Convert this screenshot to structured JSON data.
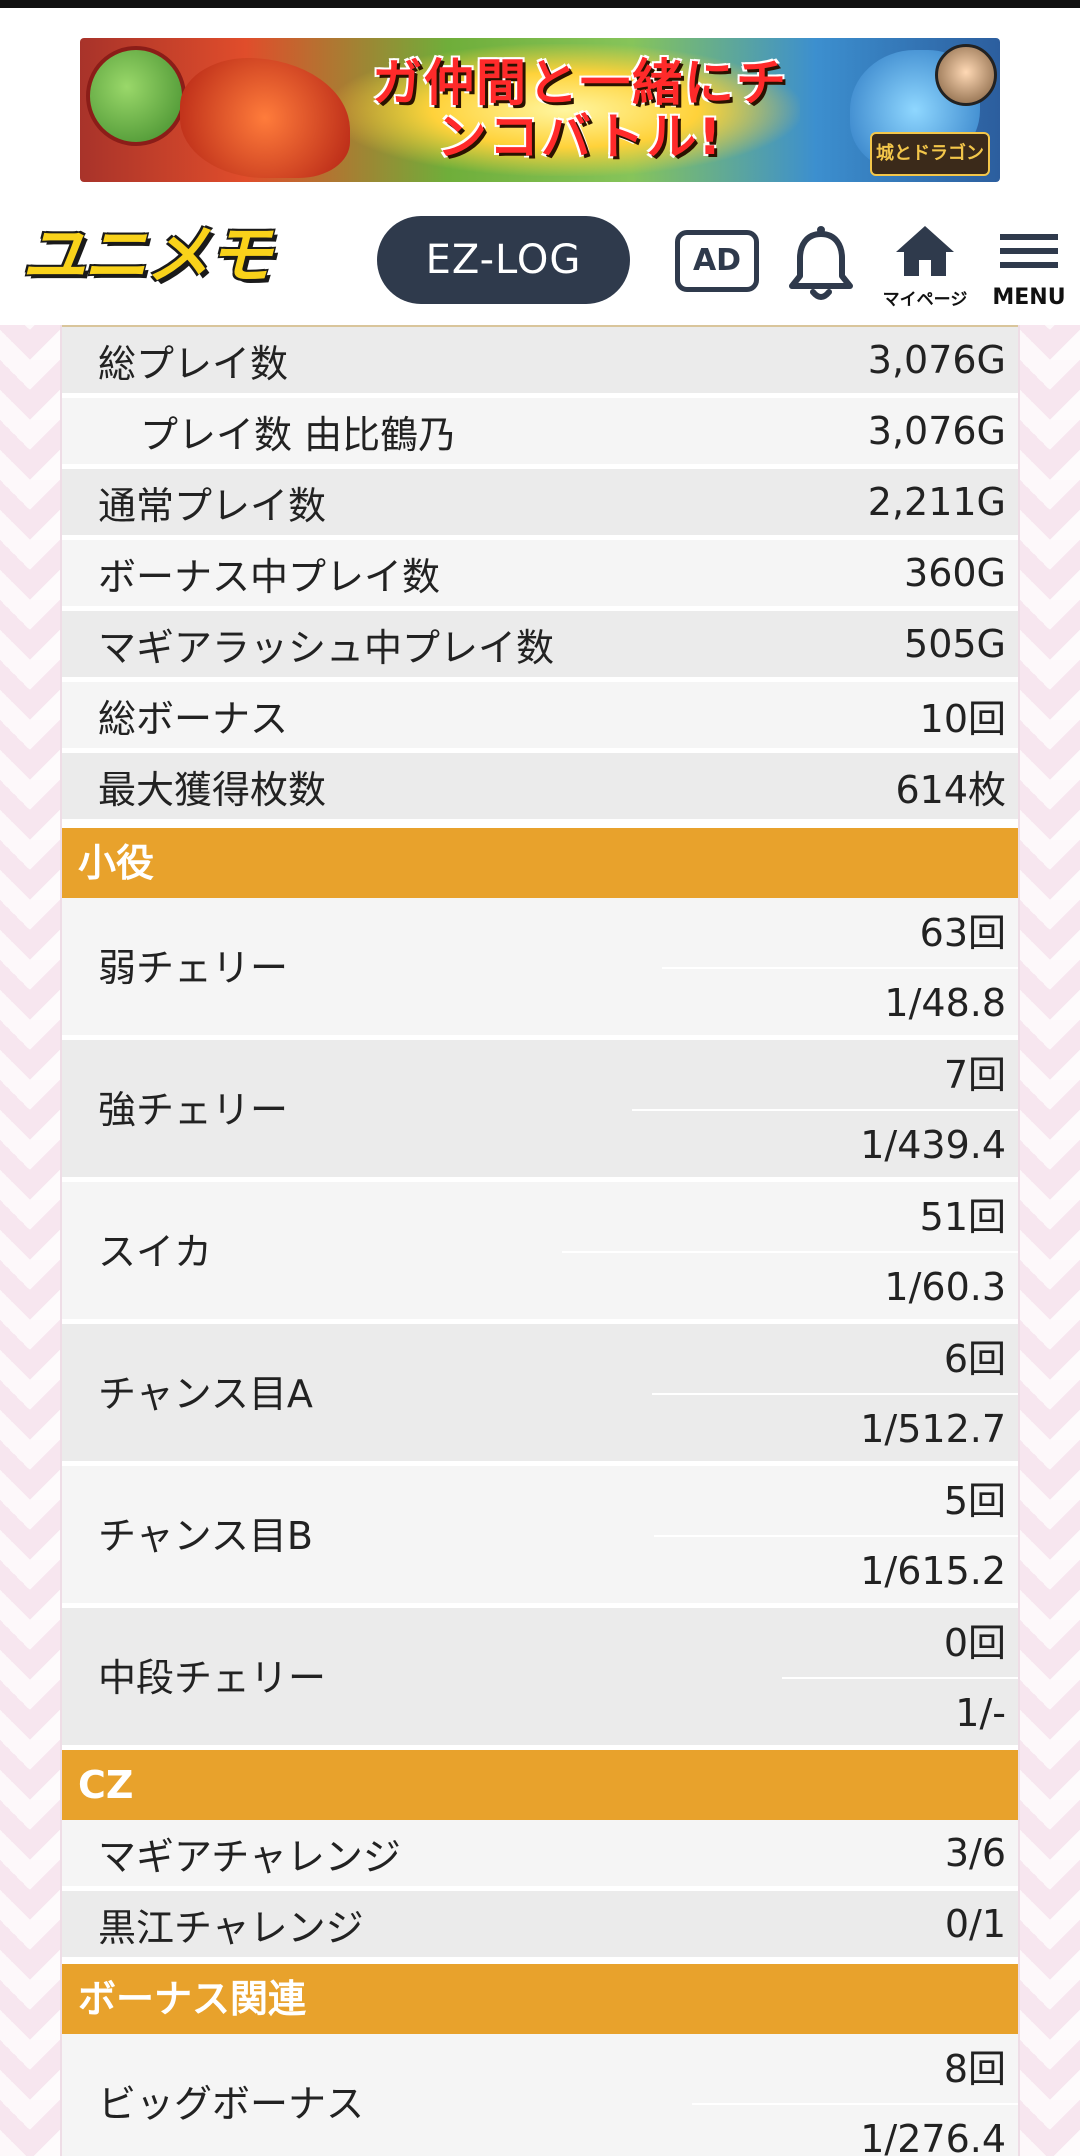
{
  "banner": {
    "headline": "ガ仲間と一緒にチンコバトル!",
    "game_logo": "城とドラゴン"
  },
  "nav": {
    "logo": "ユニメモ",
    "ezlog": "EZ-LOG",
    "ad": "AD",
    "mypage_label": "マイページ",
    "menu_label": "MENU"
  },
  "stats": [
    {
      "label": "総プレイ数",
      "value": "3,076G",
      "indent": false
    },
    {
      "label": "プレイ数 由比鶴乃",
      "value": "3,076G",
      "indent": true
    },
    {
      "label": "通常プレイ数",
      "value": "2,211G",
      "indent": false
    },
    {
      "label": "ボーナス中プレイ数",
      "value": "360G",
      "indent": false
    },
    {
      "label": "マギアラッシュ中プレイ数",
      "value": "505G",
      "indent": false
    },
    {
      "label": "総ボーナス",
      "value": "10回",
      "indent": false
    },
    {
      "label": "最大獲得枚数",
      "value": "614枚",
      "indent": false
    }
  ],
  "sections": {
    "koyaku": "小役",
    "cz": "CZ",
    "bonus": "ボーナス関連"
  },
  "koyaku": [
    {
      "label": "弱チェリー",
      "count": "63回",
      "prob": "1/48.8"
    },
    {
      "label": "強チェリー",
      "count": "7回",
      "prob": "1/439.4"
    },
    {
      "label": "スイカ",
      "count": "51回",
      "prob": "1/60.3"
    },
    {
      "label": "チャンス目A",
      "count": "6回",
      "prob": "1/512.7"
    },
    {
      "label": "チャンス目B",
      "count": "5回",
      "prob": "1/615.2"
    },
    {
      "label": "中段チェリー",
      "count": "0回",
      "prob": "1/-"
    }
  ],
  "cz": [
    {
      "label": "マギアチャレンジ",
      "value": "3/6"
    },
    {
      "label": "黒江チャレンジ",
      "value": "0/1"
    }
  ],
  "bonus": [
    {
      "label": "ビッグボーナス",
      "count": "8回",
      "prob": "1/276.4"
    }
  ]
}
